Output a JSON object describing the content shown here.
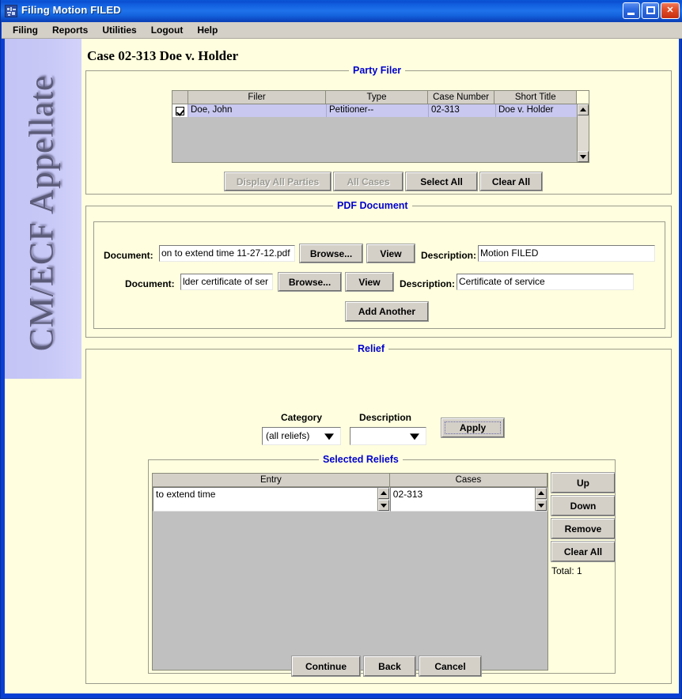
{
  "window": {
    "title": "Filing Motion FILED",
    "icon": "app-icon",
    "minimize_label": "Minimize",
    "maximize_label": "Maximize",
    "close_label": "Close",
    "close_glyph": "✕"
  },
  "menubar": {
    "items": [
      {
        "label": "Filing"
      },
      {
        "label": "Reports"
      },
      {
        "label": "Utilities"
      },
      {
        "label": "Logout"
      },
      {
        "label": "Help"
      }
    ]
  },
  "sidebar": {
    "brand": "CM/ECF Appellate"
  },
  "main": {
    "case_title": "Case 02-313 Doe v. Holder"
  },
  "party_filer": {
    "group_title": "Party Filer",
    "columns": [
      "",
      "Filer",
      "Type",
      "Case Number",
      "Short Title"
    ],
    "rows": [
      {
        "checked": true,
        "filer": "Doe, John",
        "type": "Petitioner--",
        "case_number": "02-313",
        "short_title": "Doe v. Holder"
      }
    ],
    "buttons": [
      {
        "label": "Display All Parties",
        "disabled": true
      },
      {
        "label": "All Cases",
        "disabled": true
      },
      {
        "label": "Select All",
        "disabled": false
      },
      {
        "label": "Clear All",
        "disabled": false
      }
    ]
  },
  "pdf_document": {
    "group_title": "PDF Document",
    "rows": [
      {
        "document_label": "Document:",
        "document_value": "on to extend time 11-27-12.pdf",
        "browse_label": "Browse...",
        "view_label": "View",
        "description_label": "Description:",
        "description_value": "Motion FILED"
      },
      {
        "document_label": "Document:",
        "document_value": "lder certificate of ser",
        "browse_label": "Browse...",
        "view_label": "View",
        "description_label": "Description:",
        "description_value": "Certificate of service"
      }
    ],
    "add_another_label": "Add Another"
  },
  "relief": {
    "group_title": "Relief",
    "category_label": "Category",
    "category_value": "(all reliefs)",
    "description_label": "Description",
    "description_value": "",
    "apply_label": "Apply",
    "selected": {
      "group_title": "Selected Reliefs",
      "columns": [
        "Entry",
        "Cases"
      ],
      "rows": [
        {
          "entry": "to extend time",
          "cases": "02-313"
        }
      ],
      "buttons": [
        {
          "label": "Up"
        },
        {
          "label": "Down"
        },
        {
          "label": "Remove"
        },
        {
          "label": "Clear All"
        }
      ],
      "total_label": "Total: 1"
    }
  },
  "footer": {
    "buttons": [
      {
        "label": "Continue"
      },
      {
        "label": "Back"
      },
      {
        "label": "Cancel"
      }
    ]
  },
  "colors": {
    "titlebar_blue": "#1f72ea",
    "window_border": "#0a3fd4",
    "client_bg": "#ffffdf",
    "sidebar_bg": "#c9c9f7",
    "group_title": "#0000cc",
    "row_selected": "#c8c8f0",
    "control_face": "#d4d0c8"
  }
}
